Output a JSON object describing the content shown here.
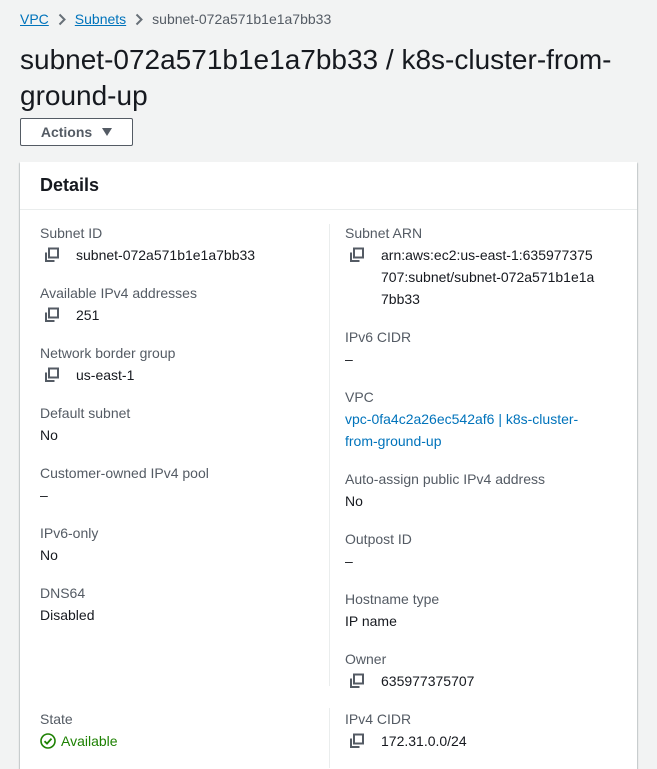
{
  "breadcrumb": {
    "items": [
      "VPC",
      "Subnets"
    ],
    "current": "subnet-072a571b1e1a7bb33"
  },
  "page": {
    "title": "subnet-072a571b1e1a7bb33 / k8s-cluster-from-ground-up",
    "actions_label": "Actions"
  },
  "details": {
    "title": "Details",
    "left": [
      {
        "label": "Subnet ID",
        "value": "subnet-072a571b1e1a7bb33",
        "copy": true
      },
      {
        "label": "Available IPv4 addresses",
        "value": "251",
        "copy": true
      },
      {
        "label": "Network border group",
        "value": "us-east-1",
        "copy": true
      },
      {
        "label": "Default subnet",
        "value": "No"
      },
      {
        "label": "Customer-owned IPv4 pool",
        "value": "–"
      },
      {
        "label": "IPv6-only",
        "value": "No"
      },
      {
        "label": "DNS64",
        "value": "Disabled"
      },
      {
        "label": "State",
        "value": "Available",
        "status": "success"
      }
    ],
    "right": [
      {
        "label": "Subnet ARN",
        "value": "arn:aws:ec2:us-east-1:635977375707:subnet/subnet-072a571b1e1a7bb33",
        "copy": true
      },
      {
        "label": "IPv6 CIDR",
        "value": "–"
      },
      {
        "label": "VPC",
        "value": "vpc-0fa4c2a26ec542af6 | k8s-cluster-from-ground-up",
        "link": true
      },
      {
        "label": "Auto-assign public IPv4 address",
        "value": "No"
      },
      {
        "label": "Outpost ID",
        "value": "–"
      },
      {
        "label": "Hostname type",
        "value": "IP name"
      },
      {
        "label": "Owner",
        "value": "635977375707",
        "copy": true
      },
      {
        "label": "IPv4 CIDR",
        "value": "172.31.0.0/24",
        "copy": true
      }
    ]
  },
  "colors": {
    "link": "#0073bb",
    "success": "#1d8102",
    "text": "#16191f",
    "label": "#545b64",
    "background": "#f2f3f3"
  },
  "icons": {
    "breadcrumb_separator": "chevron-right-icon",
    "copy": "copy-icon",
    "status": "status-positive-icon",
    "dropdown": "caret-down-icon"
  }
}
